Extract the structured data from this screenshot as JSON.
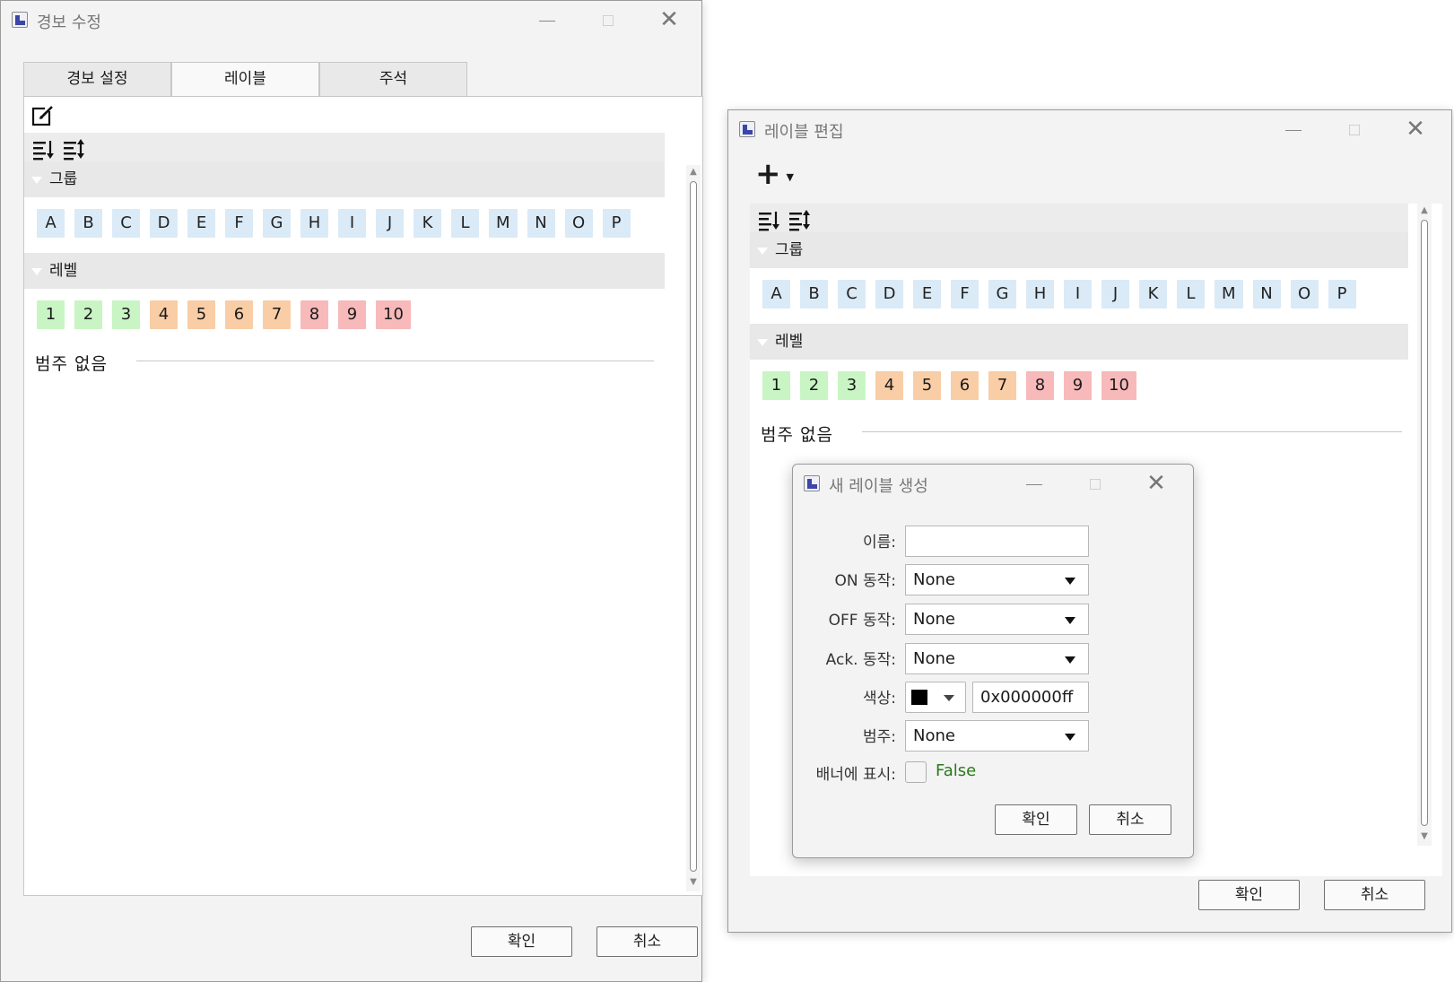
{
  "colors": {
    "group_chip": "#daeaf7",
    "level_green": "#c9f5c4",
    "level_orange": "#f9cda5",
    "level_red": "#f7b9b9",
    "false_text": "#2a7a1c"
  },
  "alarm_window": {
    "title": "경보 수정",
    "tabs": [
      "경보 설정",
      "레이블",
      "주석"
    ],
    "active_tab": "레이블",
    "group_header": "그룹",
    "level_header": "레벨",
    "groups": [
      "A",
      "B",
      "C",
      "D",
      "E",
      "F",
      "G",
      "H",
      "I",
      "J",
      "K",
      "L",
      "M",
      "N",
      "O",
      "P"
    ],
    "levels": [
      "1",
      "2",
      "3",
      "4",
      "5",
      "6",
      "7",
      "8",
      "9",
      "10"
    ],
    "no_category": "범주 없음",
    "ok": "확인",
    "cancel": "취소"
  },
  "label_window": {
    "title": "레이블 편집",
    "group_header": "그룹",
    "level_header": "레벨",
    "groups": [
      "A",
      "B",
      "C",
      "D",
      "E",
      "F",
      "G",
      "H",
      "I",
      "J",
      "K",
      "L",
      "M",
      "N",
      "O",
      "P"
    ],
    "levels": [
      "1",
      "2",
      "3",
      "4",
      "5",
      "6",
      "7",
      "8",
      "9",
      "10"
    ],
    "no_category": "범주 없음",
    "ok": "확인",
    "cancel": "취소"
  },
  "new_label_dialog": {
    "title": "새 레이블 생성",
    "name_label": "이름:",
    "name_value": "",
    "on_action_label": "ON 동작:",
    "on_action_value": "None",
    "off_action_label": "OFF 동작:",
    "off_action_value": "None",
    "ack_action_label": "Ack. 동작:",
    "ack_action_value": "None",
    "color_label": "색상:",
    "color_value": "0x000000ff",
    "category_label": "범주:",
    "category_value": "None",
    "banner_label": "배너에 표시:",
    "banner_value": "False",
    "ok": "확인",
    "cancel": "취소"
  }
}
